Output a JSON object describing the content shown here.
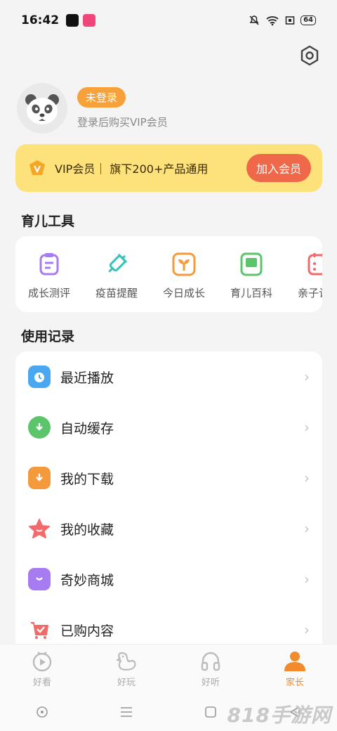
{
  "status_bar": {
    "time": "16:42",
    "battery": "64"
  },
  "profile": {
    "badge": "未登录",
    "hint": "登录后购买VIP会员"
  },
  "vip": {
    "text": "VIP会员｜ 旗下200+产品通用",
    "button": "加入会员"
  },
  "tools": {
    "title": "育儿工具",
    "items": [
      {
        "label": "成长测评",
        "icon": "clipboard-icon",
        "color": "#a77cf0"
      },
      {
        "label": "疫苗提醒",
        "icon": "syringe-icon",
        "color": "#35c5b8"
      },
      {
        "label": "今日成长",
        "icon": "sprout-icon",
        "color": "#f59a3c"
      },
      {
        "label": "育儿百科",
        "icon": "book-icon",
        "color": "#5cc46b"
      },
      {
        "label": "亲子计划",
        "icon": "calendar-icon",
        "color": "#f06a6a"
      }
    ]
  },
  "records": {
    "title": "使用记录",
    "items": [
      {
        "label": "最近播放",
        "icon": "clock-icon",
        "color": "#4aa8f0"
      },
      {
        "label": "自动缓存",
        "icon": "download-cloud-icon",
        "color": "#5cc46b"
      },
      {
        "label": "我的下载",
        "icon": "download-folder-icon",
        "color": "#f59a3c"
      },
      {
        "label": "我的收藏",
        "icon": "star-icon",
        "color": "#f26a6a"
      },
      {
        "label": "奇妙商城",
        "icon": "shopping-bag-icon",
        "color": "#a77cf0"
      },
      {
        "label": "已购内容",
        "icon": "cart-icon",
        "color": "#f06a6a"
      }
    ]
  },
  "tabs": [
    {
      "label": "好看",
      "icon": "play-tv-icon"
    },
    {
      "label": "好玩",
      "icon": "duck-icon"
    },
    {
      "label": "好听",
      "icon": "headphones-icon"
    },
    {
      "label": "家长",
      "icon": "parent-icon",
      "active": true
    }
  ],
  "watermark": "818手游网",
  "colors": {
    "accent": "#f28a2e",
    "vip_bg": "#fde27c",
    "vip_button": "#f0684a",
    "badge": "#f7a13a"
  }
}
